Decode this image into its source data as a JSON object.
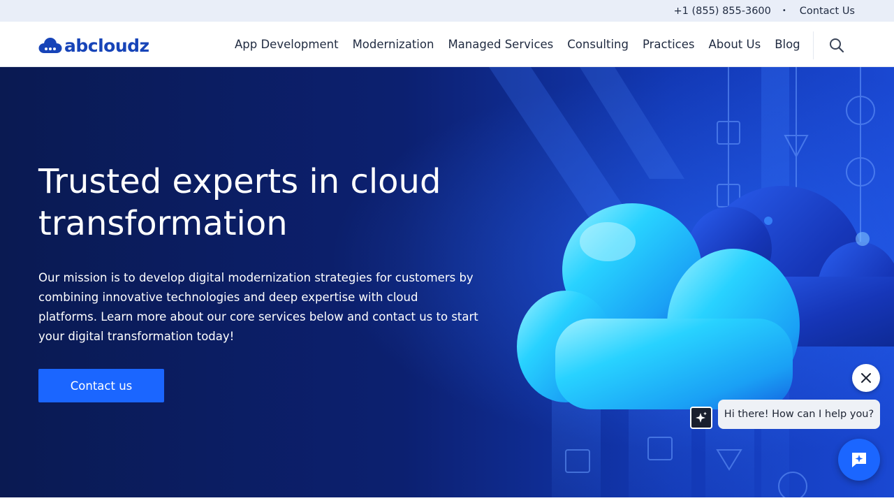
{
  "utility_bar": {
    "phone": "+1 (855) 855-3600",
    "separator": "•",
    "contact_link": "Contact Us"
  },
  "header": {
    "logo_text": "abcloudz",
    "logo_icon": "cloud-logo-icon",
    "nav_items": [
      {
        "label": "App Development"
      },
      {
        "label": "Modernization"
      },
      {
        "label": "Managed Services"
      },
      {
        "label": "Consulting"
      },
      {
        "label": "Practices"
      },
      {
        "label": "About Us"
      },
      {
        "label": "Blog"
      }
    ],
    "search_icon": "search-icon"
  },
  "hero": {
    "title": "Trusted experts in cloud transformation",
    "description": "Our mission is to develop digital modernization strategies for customers by combining innovative technologies and deep expertise with cloud platforms. Learn more about our core services below and contact us to start your digital transformation today!",
    "cta_label": "Contact us"
  },
  "chat": {
    "greeting": "Hi there! How can I help you?",
    "close_icon": "close-icon",
    "avatar_icon": "sparkle-icon",
    "launcher_icon": "chat-sparkle-icon"
  },
  "colors": {
    "brand_blue": "#1744b8",
    "cta_blue": "#1b66ff",
    "hero_dark": "#0a1a52",
    "utility_bg": "#e9eef8"
  }
}
